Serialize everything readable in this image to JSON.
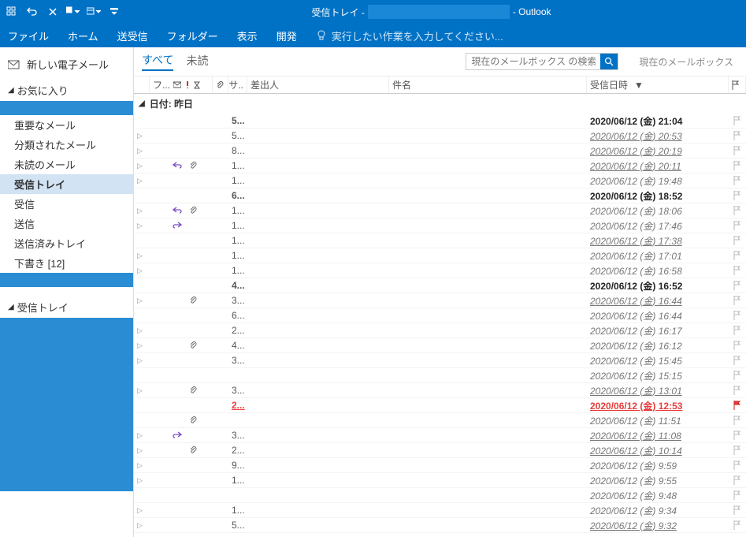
{
  "title_prefix": "受信トレイ -",
  "title_suffix": "- Outlook",
  "ribbon_tabs": [
    "ファイル",
    "ホーム",
    "送受信",
    "フォルダー",
    "表示",
    "開発"
  ],
  "tellme": "実行したい作業を入力してください...",
  "nav": {
    "new_mail": "新しい電子メール",
    "favorites_header": "お気に入り",
    "favorites": [
      "",
      "重要なメール",
      "分類されたメール",
      "未読のメール",
      "受信トレイ",
      "受信",
      "送信",
      "送信済みトレイ",
      "下書き [12]",
      ""
    ],
    "selected_index": 4,
    "inbox_tree_header": "受信トレイ"
  },
  "filter": {
    "all": "すべて",
    "unread": "未読",
    "search_placeholder": "現在のメールボックス の検索 (Ctrl+E)",
    "scope": "現在のメールボックス"
  },
  "columns": {
    "flagbits": "フ...",
    "attach_optional": "サ..",
    "sender": "差出人",
    "subject": "件名",
    "date": "受信日時"
  },
  "group_header": "日付: 昨日",
  "rows": [
    {
      "num": "5...",
      "date": "2020/06/12 (金) 21:04",
      "state": "unread",
      "attach": false,
      "expand": false,
      "reply": false,
      "forward": false
    },
    {
      "num": "5...",
      "date": "2020/06/12 (金) 20:53",
      "state": "read",
      "under": true,
      "attach": false,
      "expand": true,
      "reply": false,
      "forward": false
    },
    {
      "num": "8...",
      "date": "2020/06/12 (金) 20:19",
      "state": "read",
      "under": true,
      "attach": false,
      "expand": true,
      "reply": false,
      "forward": false
    },
    {
      "num": "1...",
      "date": "2020/06/12 (金) 20:11",
      "state": "read",
      "under": true,
      "attach": true,
      "expand": true,
      "reply": true,
      "forward": false
    },
    {
      "num": "1...",
      "date": "2020/06/12 (金) 19:48",
      "state": "read",
      "under": false,
      "attach": false,
      "expand": true,
      "reply": false,
      "forward": false
    },
    {
      "num": "6...",
      "date": "2020/06/12 (金) 18:52",
      "state": "unread",
      "attach": false,
      "expand": false,
      "reply": false,
      "forward": false
    },
    {
      "num": "1...",
      "date": "2020/06/12 (金) 18:06",
      "state": "read",
      "under": false,
      "attach": true,
      "expand": true,
      "reply": true,
      "forward": false
    },
    {
      "num": "1...",
      "date": "2020/06/12 (金) 17:46",
      "state": "read",
      "under": false,
      "attach": false,
      "expand": true,
      "reply": false,
      "forward": true
    },
    {
      "num": "1...",
      "date": "2020/06/12 (金) 17:38",
      "state": "read",
      "under": true,
      "attach": false,
      "expand": false,
      "reply": false,
      "forward": false
    },
    {
      "num": "1...",
      "date": "2020/06/12 (金) 17:01",
      "state": "read",
      "under": false,
      "attach": false,
      "expand": true,
      "reply": false,
      "forward": false
    },
    {
      "num": "1...",
      "date": "2020/06/12 (金) 16:58",
      "state": "read",
      "under": false,
      "attach": false,
      "expand": true,
      "reply": false,
      "forward": false
    },
    {
      "num": "4...",
      "date": "2020/06/12 (金) 16:52",
      "state": "unread",
      "attach": false,
      "expand": false,
      "reply": false,
      "forward": false
    },
    {
      "num": "3...",
      "date": "2020/06/12 (金) 16:44",
      "state": "read",
      "under": true,
      "attach": true,
      "expand": true,
      "reply": false,
      "forward": false
    },
    {
      "num": "6...",
      "date": "2020/06/12 (金) 16:44",
      "state": "read",
      "under": false,
      "attach": false,
      "expand": false,
      "reply": false,
      "forward": false
    },
    {
      "num": "2...",
      "date": "2020/06/12 (金) 16:17",
      "state": "read",
      "under": false,
      "attach": false,
      "expand": true,
      "reply": false,
      "forward": false
    },
    {
      "num": "4...",
      "date": "2020/06/12 (金) 16:12",
      "state": "read",
      "under": false,
      "attach": true,
      "expand": true,
      "reply": false,
      "forward": false
    },
    {
      "num": "3...",
      "date": "2020/06/12 (金) 15:45",
      "state": "read",
      "under": false,
      "attach": false,
      "expand": true,
      "reply": false,
      "forward": false
    },
    {
      "num": "",
      "date": "2020/06/12 (金) 15:15",
      "state": "read",
      "under": false,
      "attach": false,
      "expand": false,
      "reply": false,
      "forward": false
    },
    {
      "num": "3...",
      "date": "2020/06/12 (金) 13:01",
      "state": "read",
      "under": true,
      "attach": true,
      "expand": true,
      "reply": false,
      "forward": false
    },
    {
      "num": "2...",
      "date": "2020/06/12 (金) 12:53",
      "state": "red",
      "attach": false,
      "expand": false,
      "reply": false,
      "forward": false,
      "redbar": true
    },
    {
      "num": "",
      "date": "2020/06/12 (金) 11:51",
      "state": "read",
      "under": false,
      "attach": true,
      "expand": false,
      "reply": false,
      "forward": false
    },
    {
      "num": "3...",
      "date": "2020/06/12 (金) 11:08",
      "state": "read",
      "under": true,
      "attach": false,
      "expand": true,
      "reply": false,
      "forward": true
    },
    {
      "num": "2...",
      "date": "2020/06/12 (金) 10:14",
      "state": "read",
      "under": true,
      "attach": true,
      "expand": true,
      "reply": false,
      "forward": false
    },
    {
      "num": "9...",
      "date": "2020/06/12 (金) 9:59",
      "state": "read",
      "under": false,
      "attach": false,
      "expand": true,
      "reply": false,
      "forward": false
    },
    {
      "num": "1...",
      "date": "2020/06/12 (金) 9:55",
      "state": "read",
      "under": false,
      "attach": false,
      "expand": true,
      "reply": false,
      "forward": false
    },
    {
      "num": "",
      "date": "2020/06/12 (金) 9:48",
      "state": "read",
      "under": false,
      "attach": false,
      "expand": false,
      "reply": false,
      "forward": false
    },
    {
      "num": "1...",
      "date": "2020/06/12 (金) 9:34",
      "state": "read",
      "under": false,
      "attach": false,
      "expand": true,
      "reply": false,
      "forward": false
    },
    {
      "num": "5...",
      "date": "2020/06/12 (金) 9:32",
      "state": "read",
      "under": true,
      "attach": false,
      "expand": true,
      "reply": false,
      "forward": false
    }
  ]
}
